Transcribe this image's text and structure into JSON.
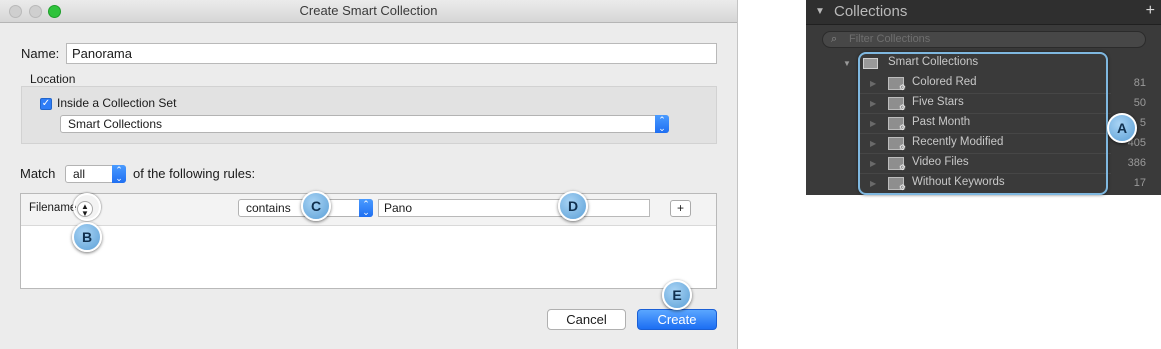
{
  "dialog": {
    "title": "Create Smart Collection",
    "name_label": "Name:",
    "name_value": "Panorama",
    "location_label": "Location",
    "inside_set_label": "Inside a Collection Set",
    "inside_set_checked": true,
    "collection_set_value": "Smart Collections",
    "match_label": "Match",
    "match_value": "all",
    "rules_suffix": "of the following rules:",
    "rule": {
      "field": "Filename",
      "operator": "contains",
      "value": "Pano",
      "add_label": "+"
    },
    "cancel_label": "Cancel",
    "create_label": "Create",
    "accent_color": "#1c6ef3"
  },
  "callouts": {
    "a": "A",
    "b": "B",
    "c": "C",
    "d": "D",
    "e": "E"
  },
  "panel": {
    "title": "Collections",
    "plus_label": "+",
    "filter_placeholder": "Filter Collections",
    "parent": "Smart Collections",
    "items": [
      {
        "name": "Colored Red",
        "count": "81"
      },
      {
        "name": "Five Stars",
        "count": "50"
      },
      {
        "name": "Past Month",
        "count": "5"
      },
      {
        "name": "Recently Modified",
        "count": "405"
      },
      {
        "name": "Video Files",
        "count": "386"
      },
      {
        "name": "Without Keywords",
        "count": "17"
      }
    ]
  }
}
